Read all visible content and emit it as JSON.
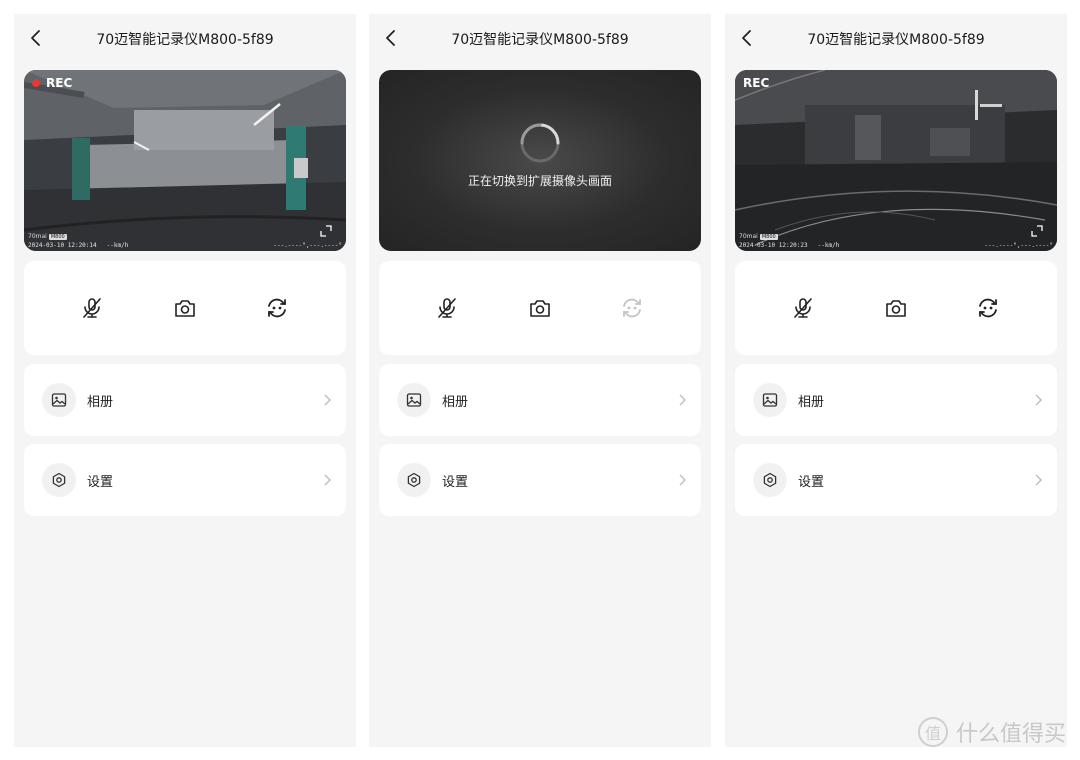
{
  "screens": [
    {
      "title": "70迈智能记录仪M800-5f89",
      "preview": {
        "state": "live",
        "rec": "REC",
        "brand": "70mai",
        "model_badge": "M800",
        "timestamp": "2024-03-10 12:20:14",
        "speed": "--km/h",
        "gps": "---.----°,---.----°"
      },
      "controls": {
        "mute": "mic-off-icon",
        "snapshot": "camera-icon",
        "switch": "switch-camera-icon",
        "switch_enabled": true
      },
      "menu": [
        {
          "label": "相册",
          "icon": "image-icon"
        },
        {
          "label": "设置",
          "icon": "settings-hex-icon"
        }
      ]
    },
    {
      "title": "70迈智能记录仪M800-5f89",
      "preview": {
        "state": "loading",
        "loading_text": "正在切换到扩展摄像头画面"
      },
      "controls": {
        "mute": "mic-off-icon",
        "snapshot": "camera-icon",
        "switch": "switch-camera-icon",
        "switch_enabled": false
      },
      "menu": [
        {
          "label": "相册",
          "icon": "image-icon"
        },
        {
          "label": "设置",
          "icon": "settings-hex-icon"
        }
      ]
    },
    {
      "title": "70迈智能记录仪M800-5f89",
      "preview": {
        "state": "live",
        "rec": "REC",
        "brand": "70mai",
        "model_badge": "M800",
        "timestamp": "2024-03-10 12:20:23",
        "speed": "--km/h",
        "gps": "---.----°,---.----°"
      },
      "controls": {
        "mute": "mic-off-icon",
        "snapshot": "camera-icon",
        "switch": "switch-camera-icon",
        "switch_enabled": true
      },
      "menu": [
        {
          "label": "相册",
          "icon": "image-icon"
        },
        {
          "label": "设置",
          "icon": "settings-hex-icon"
        }
      ]
    }
  ],
  "watermark": {
    "logo": "值",
    "text": "什么值得买"
  },
  "colors": {
    "background": "#f5f5f5",
    "card": "#ffffff",
    "rec_dot": "#e53935",
    "icon": "#222222",
    "icon_disabled": "#c4c4c4"
  }
}
